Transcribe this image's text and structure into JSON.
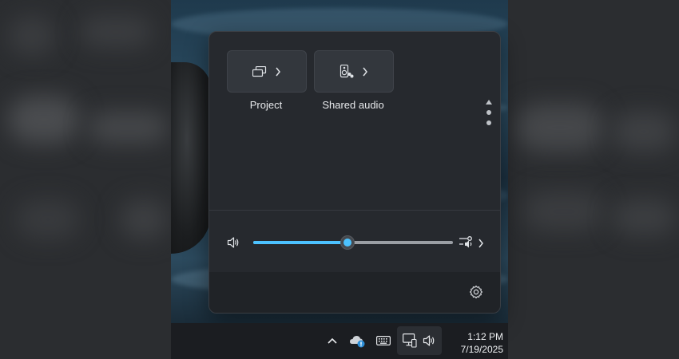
{
  "quick_settings": {
    "tiles": [
      {
        "label": "Project",
        "icon": "project-icon"
      },
      {
        "label": "Shared audio",
        "icon": "shared-audio-icon"
      }
    ],
    "volume": {
      "level": 0.47,
      "icon": "speaker-icon"
    },
    "footer": {
      "settings_icon": "gear-icon"
    }
  },
  "taskbar": {
    "tray_icons": [
      "chevron-up-icon",
      "onedrive-icon",
      "keyboard-icon",
      "network-icon",
      "speaker-icon"
    ],
    "time": "1:12 PM",
    "date": "7/19/2025"
  },
  "colors": {
    "accent": "#4cc2ff",
    "flyout_bg": "#26292e",
    "taskbar_bg": "#1b1d21"
  }
}
